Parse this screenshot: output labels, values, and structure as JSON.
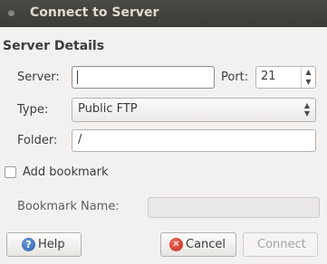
{
  "window": {
    "title": "Connect to Server"
  },
  "section": {
    "title": "Server Details"
  },
  "server": {
    "label": "Server:",
    "value": ""
  },
  "port": {
    "label": "Port:",
    "value": "21"
  },
  "type": {
    "label": "Type:",
    "selected": "Public FTP"
  },
  "folder": {
    "label": "Folder:",
    "value": "/"
  },
  "bookmark": {
    "checkbox_label": "Add bookmark",
    "checked": false,
    "name_label": "Bookmark Name:",
    "name_value": ""
  },
  "buttons": {
    "help": "Help",
    "cancel": "Cancel",
    "connect": "Connect"
  },
  "icons": {
    "help": "help-icon",
    "cancel": "cancel-icon"
  },
  "colors": {
    "titlebar": "#3c3b37",
    "window_bg": "#f2f1f0"
  }
}
